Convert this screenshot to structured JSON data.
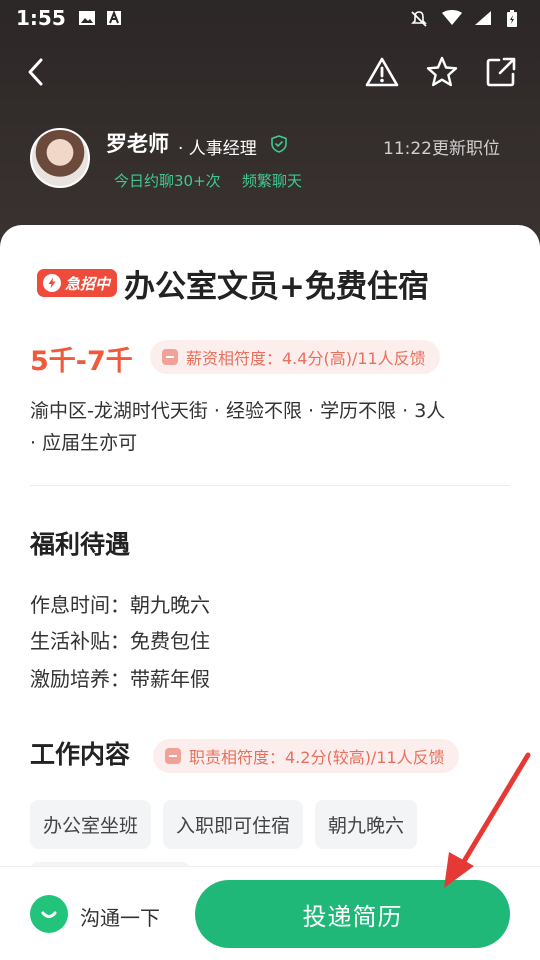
{
  "status_bar": {
    "time": "1:55"
  },
  "recruiter": {
    "name": "罗老师",
    "title": "· 人事经理",
    "update_time": "11:22更新职位",
    "tag_1": "今日约聊30+次",
    "tag_2": "频繁聊天"
  },
  "job": {
    "urgent_badge": "急招中",
    "title": "办公室文员+免费住宿",
    "salary": "5千-7千",
    "salary_fit": "薪资相符度：4.4分(高)/11人反馈",
    "meta_line_1": "渝中区-龙湖时代天街 · 经验不限 · 学历不限 · 3人",
    "meta_line_2": "· 应届生亦可"
  },
  "benefits": {
    "title": "福利待遇",
    "items": [
      "作息时间：朝九晚六",
      "生活补贴：免费包住",
      "激励培养：带薪年假"
    ]
  },
  "work": {
    "title": "工作内容",
    "fit": "职责相符度：4.2分(较高)/11人反馈",
    "tags": [
      "办公室坐班",
      "入职即可住宿",
      "朝九晚六"
    ]
  },
  "bottom_bar": {
    "chat_label": "沟通一下",
    "apply_label": "投递简历"
  },
  "colors": {
    "accent_green": "#20b879",
    "urgent_red": "#ef4b3a",
    "salary_orange": "#f05a3c",
    "annotation_red": "#e53935"
  }
}
